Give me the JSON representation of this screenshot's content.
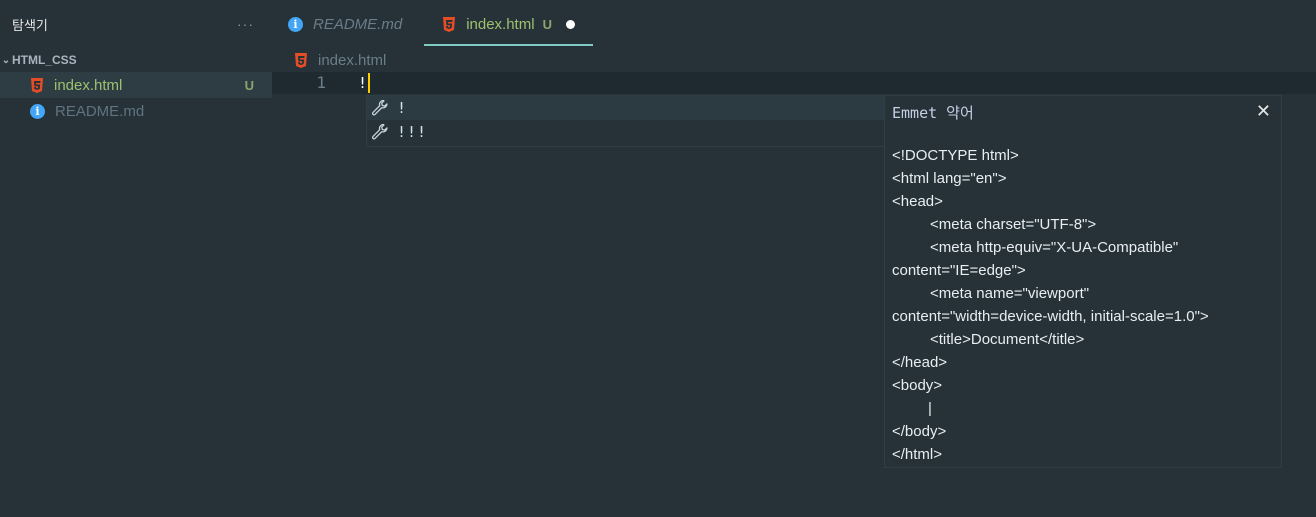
{
  "sidebar": {
    "title": "탐색기",
    "more_glyph": "···",
    "folder": {
      "name": "HTML_CSS",
      "chevron": "✓"
    },
    "files": [
      {
        "name": "index.html",
        "icon": "html5-icon",
        "badge": "U",
        "active": true
      },
      {
        "name": "README.md",
        "icon": "info-icon",
        "badge": "",
        "active": false
      }
    ]
  },
  "tabs": [
    {
      "label": "README.md",
      "icon": "info-icon",
      "active": false
    },
    {
      "label": "index.html",
      "icon": "html5-icon",
      "badge": "U",
      "active": true,
      "dirty": true
    }
  ],
  "breadcrumb": {
    "file": "index.html"
  },
  "editor": {
    "line_number": "1",
    "text": "!"
  },
  "suggest": {
    "items": [
      {
        "label": "!",
        "icon": "wrench-icon"
      },
      {
        "label": "!!!",
        "icon": "wrench-icon"
      }
    ]
  },
  "details": {
    "title": "Emmet 약어",
    "close_glyph": "✕",
    "lines": [
      "<!DOCTYPE html>",
      "<html lang=\"en\">",
      "<head>",
      "<meta charset=\"UTF-8\">",
      "<meta http-equiv=\"X-UA-Compatible\"",
      "content=\"IE=edge\">",
      "<meta name=\"viewport\"",
      "content=\"width=device-width, initial-scale=1.0\">",
      "<title>Document</title>",
      "</head>",
      "<body>",
      "|",
      "</body>",
      "</html>"
    ]
  },
  "colors": {
    "background": "#263238",
    "accent_underline": "#80cbc4",
    "html_icon": "#e44d26",
    "info_icon": "#42a5f5",
    "git_untracked": "#8ea46c",
    "cursor": "#ffcc00"
  }
}
